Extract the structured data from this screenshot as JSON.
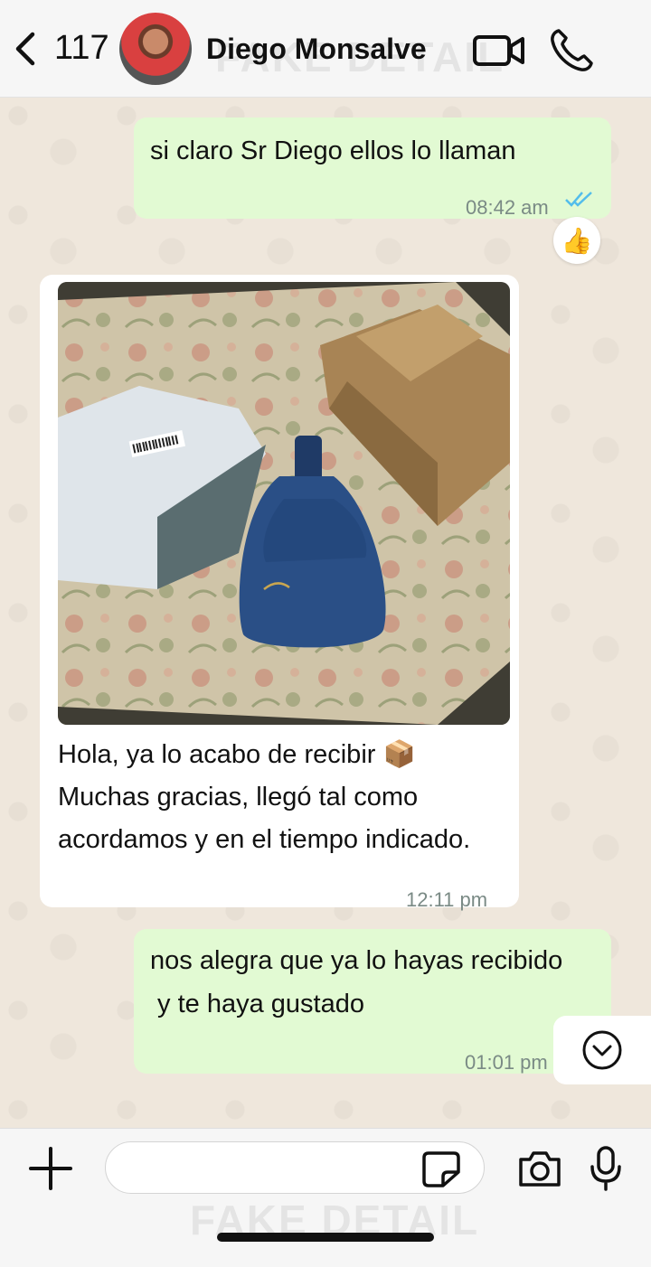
{
  "header": {
    "back_count": "117",
    "contact_name": "Diego Monsalve",
    "watermark": "FAKE DETAIL"
  },
  "messages": [
    {
      "direction": "out",
      "text": "si claro  Sr Diego ellos lo llaman",
      "time": "08:42 am",
      "status": "read",
      "reaction": "👍"
    },
    {
      "direction": "in",
      "image": "photo of a blue leather sling bag on a floral mattress next to an opened shipping bag and a cardboard box",
      "lines": [
        "Hola, ya lo acabo de recibir 📦",
        "Muchas gracias, llegó tal como",
        "acordamos y en el tiempo indicado."
      ],
      "time": "12:11 pm"
    },
    {
      "direction": "out",
      "lines": [
        "nos alegra que ya lo hayas recibido",
        " y te haya gustado"
      ],
      "time": "01:01 pm"
    }
  ],
  "colors": {
    "outgoing_bubble": "#e2fad3",
    "incoming_bubble": "#ffffff",
    "chat_background": "#efe7dc",
    "read_ticks": "#53bdeb"
  }
}
